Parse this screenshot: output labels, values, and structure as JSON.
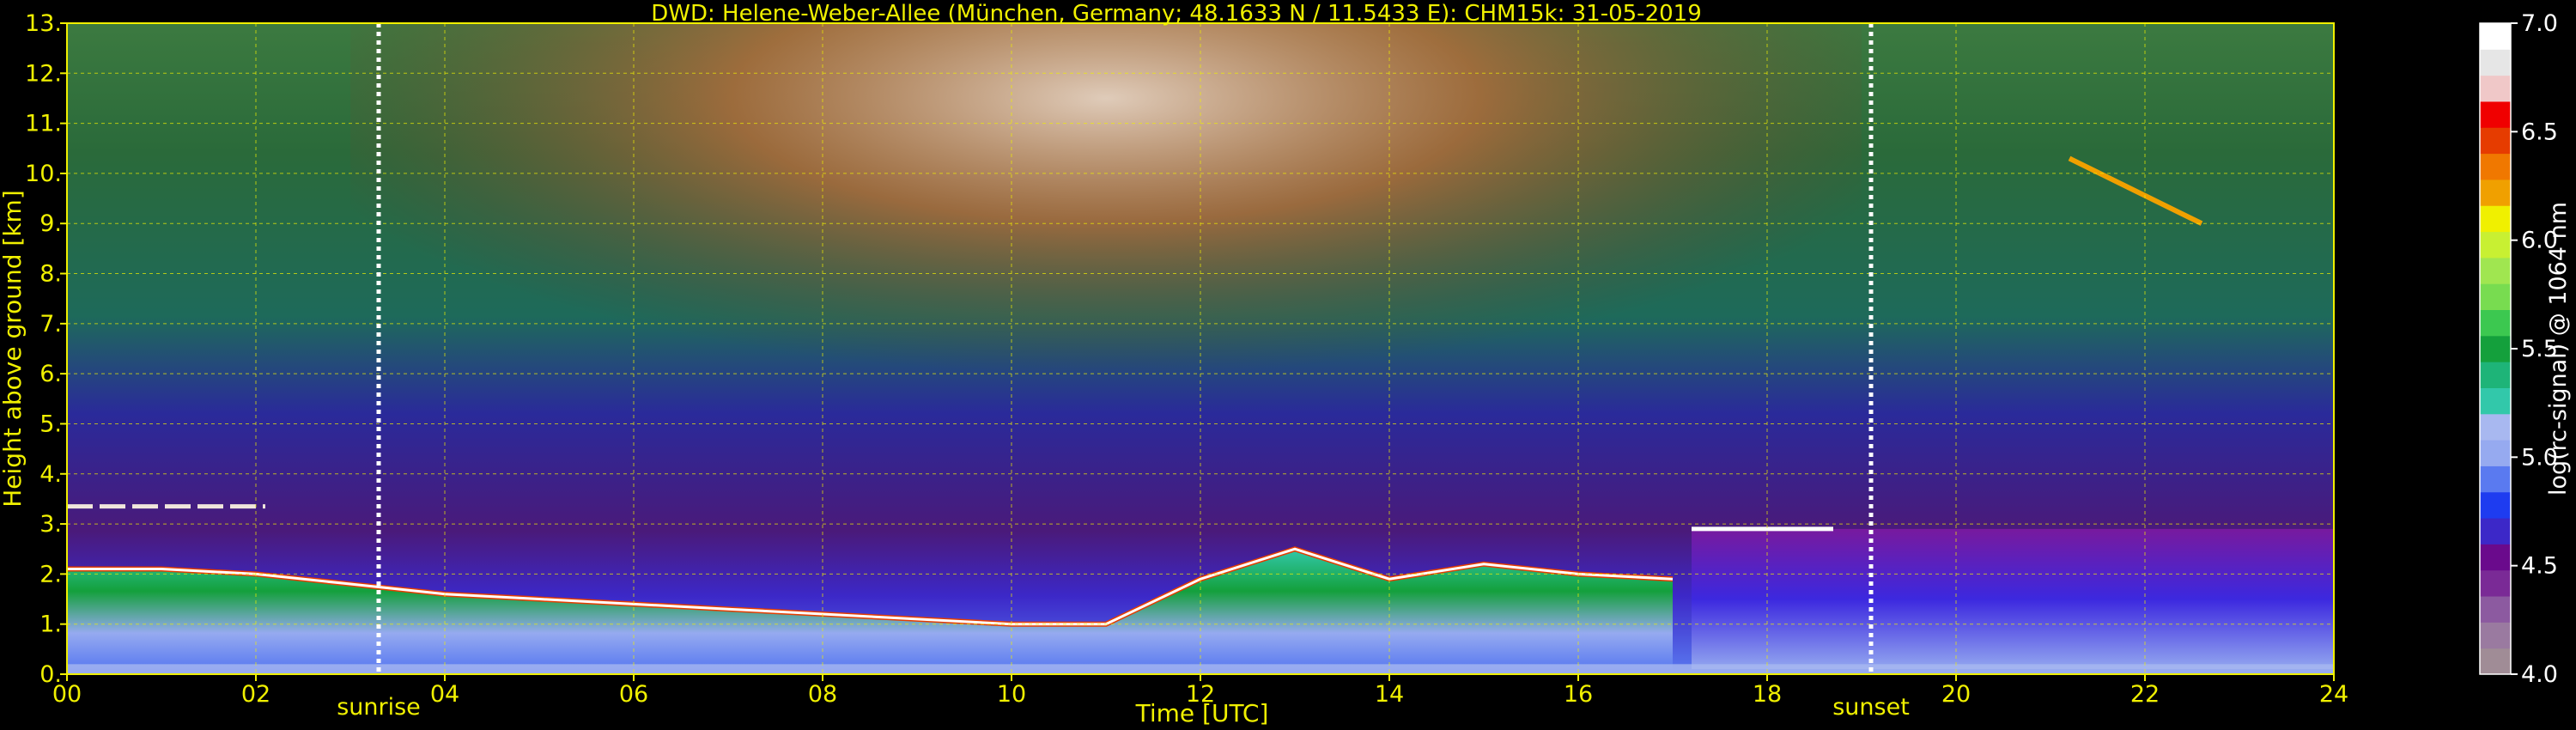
{
  "chart_data": {
    "type": "heatmap",
    "title": "DWD: Helene-Weber-Allee (München, Germany; 48.1633 N / 11.5433 E):    CHM15k: 31-05-2019",
    "xlabel": "Time [UTC]",
    "ylabel": "Height above ground [km]",
    "x_ticks": [
      "00",
      "02",
      "04",
      "06",
      "08",
      "10",
      "12",
      "14",
      "16",
      "18",
      "20",
      "22",
      "24"
    ],
    "y_ticks": [
      "0.0",
      "1.0",
      "1.",
      "2.0",
      "2.",
      "3.0",
      "3.",
      "4.0",
      "4.",
      "5.0",
      "5.",
      "6.0",
      "6.",
      "7.0",
      "7.",
      "8.0",
      "8.",
      "9.0",
      "9.",
      "10.0",
      "10.",
      "11.0",
      "11.",
      "12.0",
      "12.",
      "13.0",
      "13."
    ],
    "y_ticks_shown": [
      "0.",
      "1.",
      "2.",
      "3.",
      "4.",
      "5.",
      "6.",
      "7.",
      "8.",
      "9.",
      "10.",
      "11.",
      "12.",
      "13."
    ],
    "xlim": [
      0,
      24
    ],
    "ylim": [
      0,
      13
    ],
    "grid": true,
    "sunrise": {
      "label": "sunrise",
      "time": 3.3
    },
    "sunset": {
      "label": "sunset",
      "time": 19.1
    },
    "colorbar": {
      "label": "log(rc-signal) @ 1064 nm",
      "range": [
        4.0,
        7.0
      ],
      "ticks": [
        "4.0",
        "4.5",
        "5.0",
        "5.5",
        "6.0",
        "6.5",
        "7.0"
      ],
      "colors": [
        "#a08c96",
        "#9a7aa0",
        "#8c5aa0",
        "#7a2a96",
        "#6a0a8c",
        "#3c28c8",
        "#1e3cf0",
        "#5a7af0",
        "#96aaf0",
        "#a8b8f0",
        "#32c8aa",
        "#1eb478",
        "#14a03c",
        "#3cc850",
        "#78dc50",
        "#a0e650",
        "#c8f032",
        "#f0f000",
        "#f0a000",
        "#f07800",
        "#e63c00",
        "#f00000",
        "#f0c8c8",
        "#e6e6e6",
        "#ffffff"
      ]
    },
    "features": [
      {
        "name": "boundary-layer-top",
        "times": [
          0,
          1,
          2,
          3,
          4,
          5,
          6,
          7,
          8,
          9,
          10,
          11,
          12,
          13,
          14,
          15,
          16,
          17
        ],
        "heights": [
          2.1,
          2.1,
          2.0,
          1.8,
          1.6,
          1.5,
          1.4,
          1.3,
          1.2,
          1.1,
          1.0,
          1.0,
          1.9,
          2.5,
          1.9,
          2.2,
          2.0,
          1.9
        ]
      },
      {
        "name": "cloud-layer-evening",
        "times": [
          17.2,
          18.7
        ],
        "height": 2.9
      },
      {
        "name": "cirrus-cloud",
        "times": [
          21.2,
          22.6
        ],
        "heights": [
          9.0,
          10.3
        ]
      },
      {
        "name": "morning-aerosol-layer",
        "times": [
          0,
          2.1
        ],
        "height": 3.35
      }
    ]
  }
}
